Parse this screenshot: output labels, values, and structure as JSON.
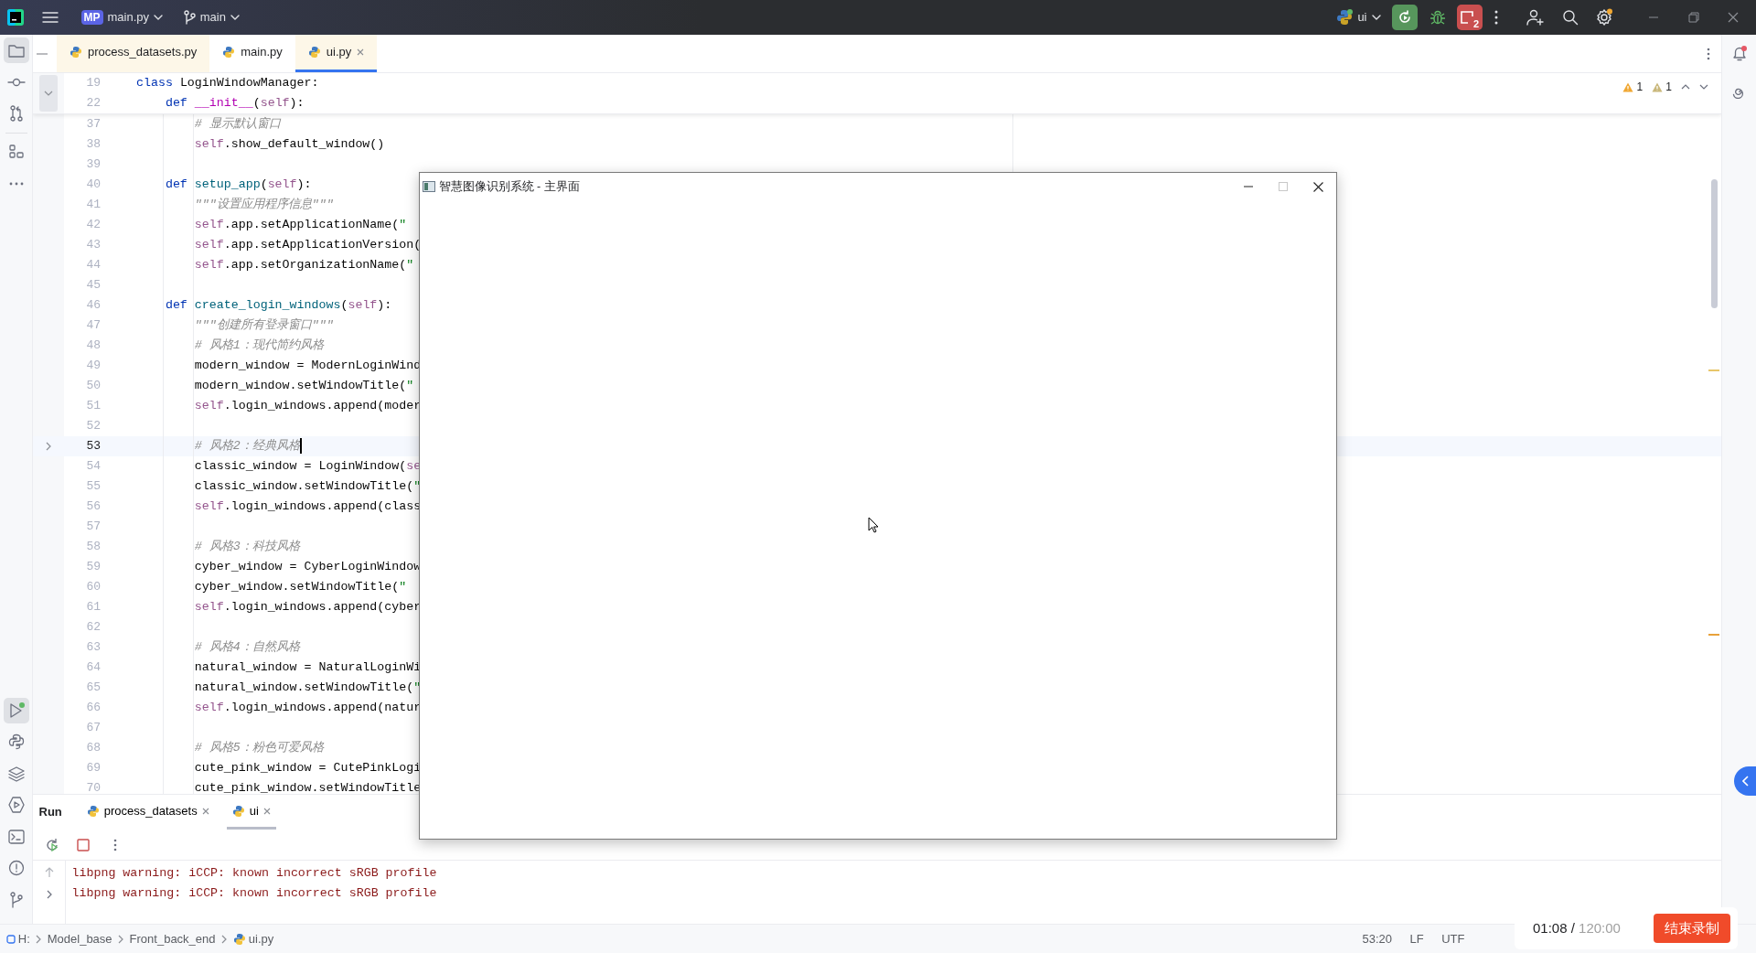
{
  "title_bar": {
    "project_badge": "MP",
    "project": "main.py",
    "branch": "main",
    "run_config": "ui",
    "stop_count": "2"
  },
  "editor_tabs": [
    {
      "label": "process_datasets.py",
      "selected": false,
      "color": "#fdf7e8"
    },
    {
      "label": "main.py",
      "selected": false,
      "color": "#ffffff"
    },
    {
      "label": "ui.py",
      "selected": true,
      "color": "#fdf7e8"
    }
  ],
  "inspections": [
    {
      "kind": "warning",
      "count": "1"
    },
    {
      "kind": "weak_warning",
      "count": "1"
    }
  ],
  "sticky_lines": [
    {
      "number": "19",
      "segments": [
        {
          "kind": "keyword",
          "text": "class"
        },
        {
          "kind": "plain",
          "text": " LoginWindowManager:"
        }
      ]
    },
    {
      "number": "22",
      "segments": [
        {
          "kind": "keyword",
          "text": "    def"
        },
        {
          "kind": "special",
          "text": " __init__"
        },
        {
          "kind": "plain",
          "text": "("
        },
        {
          "kind": "self",
          "text": "self"
        },
        {
          "kind": "plain",
          "text": "):"
        }
      ]
    }
  ],
  "code_lines": [
    {
      "number": "37",
      "current": false,
      "segments": [
        {
          "kind": "comment",
          "text": "        # 显示默认窗口"
        }
      ]
    },
    {
      "number": "38",
      "current": false,
      "segments": [
        {
          "kind": "self",
          "text": "        self"
        },
        {
          "kind": "plain",
          "text": ".show_default_window()"
        }
      ]
    },
    {
      "number": "39",
      "current": false
    },
    {
      "number": "40",
      "current": false,
      "segments": [
        {
          "kind": "keyword",
          "text": "    def"
        },
        {
          "kind": "function",
          "text": " setup_app"
        },
        {
          "kind": "plain",
          "text": "("
        },
        {
          "kind": "self",
          "text": "self"
        },
        {
          "kind": "plain",
          "text": "):"
        }
      ]
    },
    {
      "number": "41",
      "current": false,
      "segments": [
        {
          "kind": "comment",
          "text": "        \"\"\"设置应用程序信息\"\"\""
        }
      ]
    },
    {
      "number": "42",
      "current": false,
      "segments": [
        {
          "kind": "self",
          "text": "        self"
        },
        {
          "kind": "plain",
          "text": ".app.setApplicationName("
        },
        {
          "kind": "string",
          "text": "\""
        }
      ]
    },
    {
      "number": "43",
      "current": false,
      "segments": [
        {
          "kind": "self",
          "text": "        self"
        },
        {
          "kind": "plain",
          "text": ".app.setApplicationVersion("
        }
      ]
    },
    {
      "number": "44",
      "current": false,
      "segments": [
        {
          "kind": "self",
          "text": "        self"
        },
        {
          "kind": "plain",
          "text": ".app.setOrganizationName("
        },
        {
          "kind": "string",
          "text": "\""
        }
      ]
    },
    {
      "number": "45",
      "current": false
    },
    {
      "number": "46",
      "current": false,
      "segments": [
        {
          "kind": "keyword",
          "text": "    def"
        },
        {
          "kind": "function",
          "text": " create_login_windows"
        },
        {
          "kind": "plain",
          "text": "("
        },
        {
          "kind": "self",
          "text": "self"
        },
        {
          "kind": "plain",
          "text": "):"
        }
      ]
    },
    {
      "number": "47",
      "current": false,
      "segments": [
        {
          "kind": "comment",
          "text": "        \"\"\"创建所有登录窗口\"\"\""
        }
      ]
    },
    {
      "number": "48",
      "current": false,
      "segments": [
        {
          "kind": "comment",
          "text": "        # 风格1：现代简约风格"
        }
      ]
    },
    {
      "number": "49",
      "current": false,
      "segments": [
        {
          "kind": "plain",
          "text": "        modern_window = ModernLoginWind"
        }
      ]
    },
    {
      "number": "50",
      "current": false,
      "segments": [
        {
          "kind": "plain",
          "text": "        modern_window.setWindowTitle("
        },
        {
          "kind": "string",
          "text": "\""
        }
      ]
    },
    {
      "number": "51",
      "current": false,
      "segments": [
        {
          "kind": "self",
          "text": "        self"
        },
        {
          "kind": "plain",
          "text": ".login_windows.append(moder"
        }
      ]
    },
    {
      "number": "52",
      "current": false
    },
    {
      "number": "53",
      "current": true,
      "segments": [
        {
          "kind": "comment",
          "text": "        # 风格2：经典风格"
        }
      ]
    },
    {
      "number": "54",
      "current": false,
      "segments": [
        {
          "kind": "plain",
          "text": "        classic_window = LoginWindow("
        },
        {
          "kind": "self",
          "text": "se"
        }
      ]
    },
    {
      "number": "55",
      "current": false,
      "segments": [
        {
          "kind": "plain",
          "text": "        classic_window.setWindowTitle("
        },
        {
          "kind": "string",
          "text": "\""
        }
      ]
    },
    {
      "number": "56",
      "current": false,
      "segments": [
        {
          "kind": "self",
          "text": "        self"
        },
        {
          "kind": "plain",
          "text": ".login_windows.append(class"
        }
      ]
    },
    {
      "number": "57",
      "current": false
    },
    {
      "number": "58",
      "current": false,
      "segments": [
        {
          "kind": "comment",
          "text": "        # 风格3：科技风格"
        }
      ]
    },
    {
      "number": "59",
      "current": false,
      "segments": [
        {
          "kind": "plain",
          "text": "        cyber_window = CyberLoginWindow"
        }
      ]
    },
    {
      "number": "60",
      "current": false,
      "segments": [
        {
          "kind": "plain",
          "text": "        cyber_window.setWindowTitle("
        },
        {
          "kind": "string",
          "text": "\""
        }
      ]
    },
    {
      "number": "61",
      "current": false,
      "segments": [
        {
          "kind": "self",
          "text": "        self"
        },
        {
          "kind": "plain",
          "text": ".login_windows.append(cyber"
        }
      ]
    },
    {
      "number": "62",
      "current": false
    },
    {
      "number": "63",
      "current": false,
      "segments": [
        {
          "kind": "comment",
          "text": "        # 风格4：自然风格"
        }
      ]
    },
    {
      "number": "64",
      "current": false,
      "segments": [
        {
          "kind": "plain",
          "text": "        natural_window = NaturalLoginWi"
        }
      ]
    },
    {
      "number": "65",
      "current": false,
      "segments": [
        {
          "kind": "plain",
          "text": "        natural_window.setWindowTitle("
        },
        {
          "kind": "string",
          "text": "\""
        }
      ]
    },
    {
      "number": "66",
      "current": false,
      "segments": [
        {
          "kind": "self",
          "text": "        self"
        },
        {
          "kind": "plain",
          "text": ".login_windows.append(natur"
        }
      ]
    },
    {
      "number": "67",
      "current": false
    },
    {
      "number": "68",
      "current": false,
      "segments": [
        {
          "kind": "comment",
          "text": "        # 风格5：粉色可爱风格"
        }
      ]
    },
    {
      "number": "69",
      "current": false,
      "segments": [
        {
          "kind": "plain",
          "text": "        cute_pink_window = CutePinkLogi"
        }
      ]
    },
    {
      "number": "70",
      "current": false,
      "segments": [
        {
          "kind": "plain",
          "text": "        cute_pink_window.setWindowTitle"
        }
      ]
    }
  ],
  "app_window": {
    "title": "智慧图像识别系统 - 主界面"
  },
  "run_panel": {
    "label": "Run",
    "tabs": [
      {
        "label": "process_datasets",
        "selected": false
      },
      {
        "label": "ui",
        "selected": true
      }
    ],
    "output": [
      "libpng warning: iCCP: known incorrect sRGB profile",
      "libpng warning: iCCP: known incorrect sRGB profile"
    ]
  },
  "breadcrumbs": [
    "H:",
    "Model_base",
    "Front_back_end",
    "ui.py"
  ],
  "status_bar": {
    "position": "53:20",
    "line_ending": "LF",
    "encoding": "UTF"
  },
  "recording": {
    "elapsed": "01:08",
    "separator": "/",
    "total": "120:00",
    "stop_label": "结束录制"
  }
}
